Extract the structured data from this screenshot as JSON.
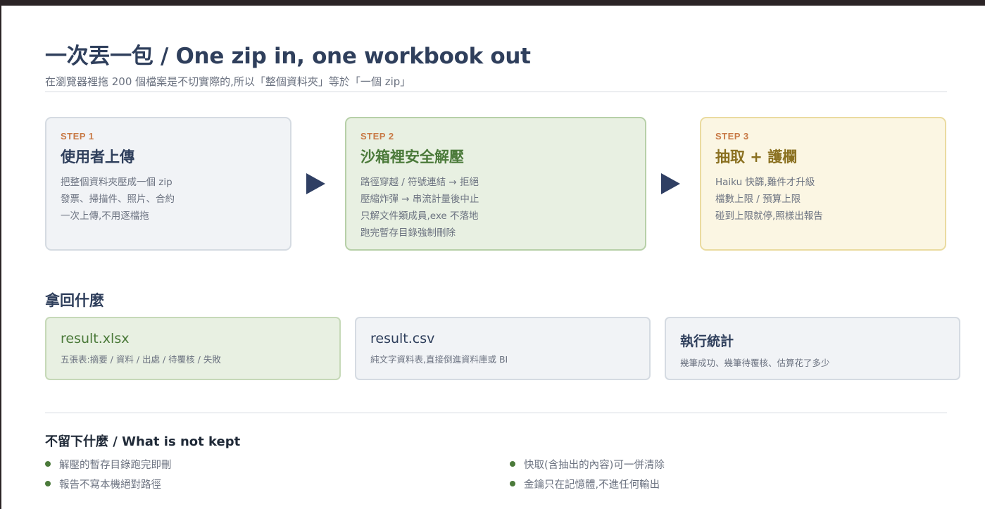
{
  "header": {
    "title": "一次丟一包 / One zip in, one workbook out",
    "subtitle": "在瀏覽器裡拖 200 個檔案是不切實際的,所以「整個資料夾」等於「一個 zip」"
  },
  "steps": [
    {
      "tag": "STEP 1",
      "title": "使用者上傳",
      "lines": [
        "把整個資料夾壓成一個 zip",
        "發票、掃描件、照片、合約",
        "一次上傳,不用逐檔拖"
      ]
    },
    {
      "tag": "STEP 2",
      "title": "沙箱裡安全解壓",
      "lines": [
        "路徑穿越 / 符號連結 → 拒絕",
        "壓縮炸彈 → 串流計量後中止",
        "只解文件類成員,exe 不落地",
        "跑完暫存目錄強制刪除"
      ]
    },
    {
      "tag": "STEP 3",
      "title": "抽取 + 護欄",
      "lines": [
        "Haiku 快篩,難件才升級",
        "檔數上限 / 預算上限",
        "碰到上限就停,照樣出報告"
      ]
    }
  ],
  "results_section": {
    "title": "拿回什麼",
    "items": [
      {
        "name": "result.xlsx",
        "desc": "五張表:摘要 / 資料 / 出處 / 待覆核 / 失敗"
      },
      {
        "name": "result.csv",
        "desc": "純文字資料表,直接倒進資料庫或 BI"
      },
      {
        "name": "執行統計",
        "desc": "幾筆成功、幾筆待覆核、估算花了多少"
      }
    ]
  },
  "not_kept": {
    "title": "不留下什麼 / What is not kept",
    "items": [
      "解壓的暫存目錄跑完即刪",
      "報告不寫本機絕對路徑",
      "快取(含抽出的內容)可一併清除",
      "金鑰只在記憶體,不進任何輸出"
    ]
  },
  "colors": {
    "accent_navy": "#2f3f5c",
    "step_tag": "#c87945",
    "green": "#4b7a3a",
    "gold": "#8a7020"
  }
}
